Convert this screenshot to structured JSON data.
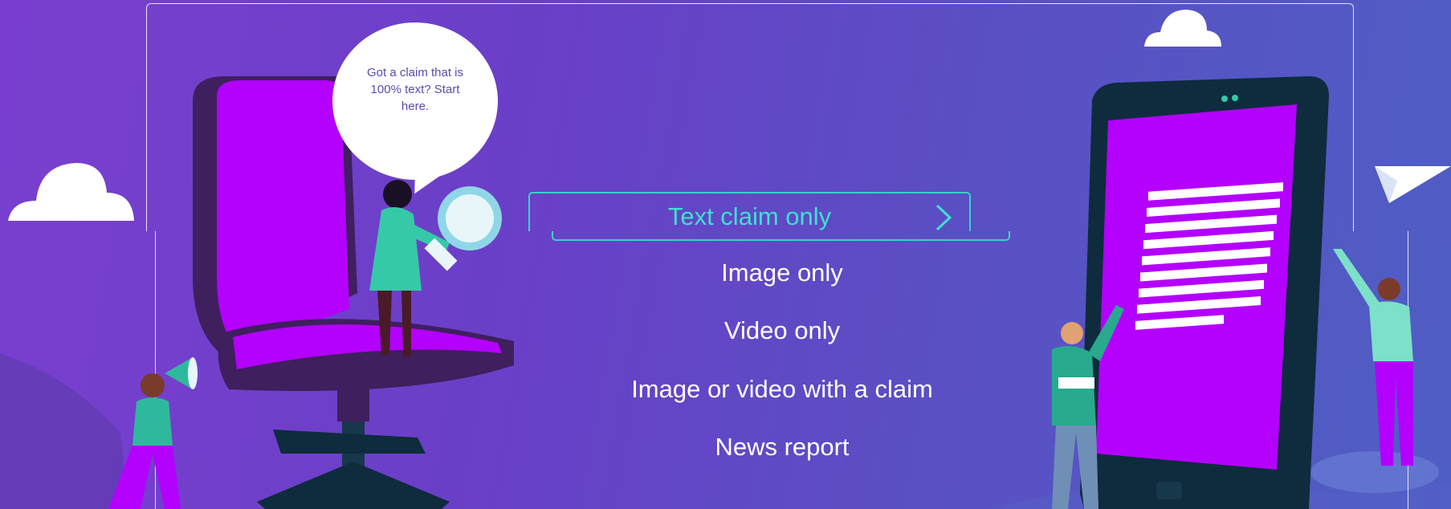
{
  "bubble": {
    "text": "Got a claim that is 100% text? Start here."
  },
  "options": {
    "selected": {
      "label": "Text claim only",
      "icon": "chevron-right-icon"
    },
    "items": [
      {
        "label": "Image only"
      },
      {
        "label": "Video only"
      },
      {
        "label": "Image or video with a claim"
      },
      {
        "label": "News report"
      }
    ]
  },
  "colors": {
    "accent": "#37d3c8",
    "purple": "#b300ff",
    "dark_purple": "#3f1f5e",
    "teal": "#29a98e"
  }
}
